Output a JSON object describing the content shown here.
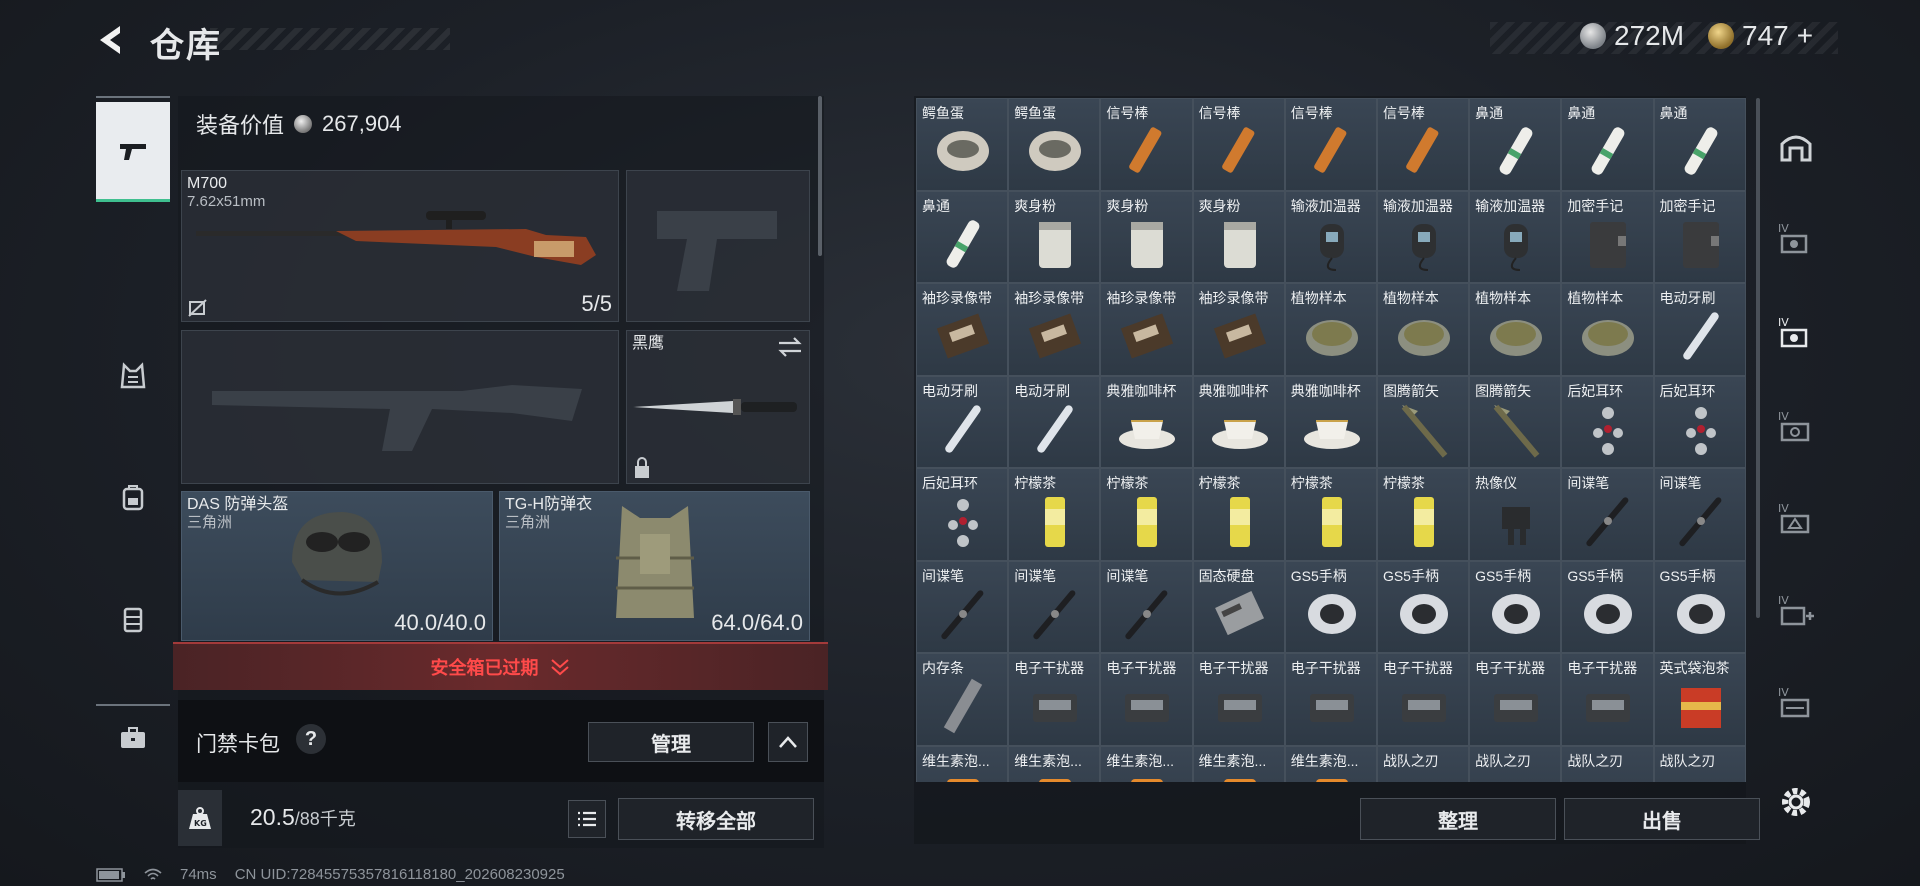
{
  "header": {
    "title": "仓库",
    "currency_silver": "272M",
    "currency_gold": "747",
    "currency_add": "+"
  },
  "sidebar_categories": [
    "weapon-icon",
    "vest-icon",
    "backpack-icon",
    "armor-icon",
    "case-icon"
  ],
  "equipment": {
    "value_label": "装备价值",
    "value": "267,904",
    "primary_weapon": {
      "name": "M700",
      "caliber": "7.62x51mm",
      "ammo": "5/5"
    },
    "melee": {
      "name": "黑鹰"
    },
    "helmet": {
      "name": "DAS 防弹头盔",
      "origin": "三角洲",
      "durability": "40.0/40.0"
    },
    "body_armor": {
      "name": "TG-H防弹衣",
      "origin": "三角洲",
      "durability": "64.0/64.0"
    }
  },
  "alert": {
    "text": "安全箱已过期"
  },
  "card_bag": {
    "label": "门禁卡包",
    "help": "?",
    "manage_label": "管理"
  },
  "weight": {
    "current": "20.5",
    "max": "/88千克",
    "transfer_all_label": "转移全部"
  },
  "warehouse": {
    "items": [
      "鳄鱼蛋",
      "鳄鱼蛋",
      "信号棒",
      "信号棒",
      "信号棒",
      "信号棒",
      "鼻通",
      "鼻通",
      "鼻通",
      "鼻通",
      "爽身粉",
      "爽身粉",
      "爽身粉",
      "输液加温器",
      "输液加温器",
      "输液加温器",
      "加密手记",
      "加密手记",
      "袖珍录像带",
      "袖珍录像带",
      "袖珍录像带",
      "袖珍录像带",
      "植物样本",
      "植物样本",
      "植物样本",
      "植物样本",
      "电动牙刷",
      "电动牙刷",
      "电动牙刷",
      "典雅咖啡杯",
      "典雅咖啡杯",
      "典雅咖啡杯",
      "图腾箭矢",
      "图腾箭矢",
      "后妃耳环",
      "后妃耳环",
      "后妃耳环",
      "柠檬茶",
      "柠檬茶",
      "柠檬茶",
      "柠檬茶",
      "柠檬茶",
      "热像仪",
      "间谍笔",
      "间谍笔",
      "间谍笔",
      "间谍笔",
      "间谍笔",
      "固态硬盘",
      "GS5手柄",
      "GS5手柄",
      "GS5手柄",
      "GS5手柄",
      "GS5手柄",
      "内存条",
      "电子干扰器",
      "电子干扰器",
      "电子干扰器",
      "电子干扰器",
      "电子干扰器",
      "电子干扰器",
      "电子干扰器",
      "英式袋泡茶",
      "维生素泡...",
      "维生素泡...",
      "维生素泡...",
      "维生素泡...",
      "维生素泡...",
      "战队之刃",
      "战队之刃",
      "战队之刃",
      "战队之刃"
    ],
    "sort_label": "整理",
    "sell_label": "出售"
  },
  "status_bar": {
    "ping": "74ms",
    "uid": "CN UID:7284557535781611818​0_202608230925"
  },
  "colors": {
    "accent": "#3fbf8f",
    "alert": "#ff4a4a",
    "cell": "#34404d"
  }
}
